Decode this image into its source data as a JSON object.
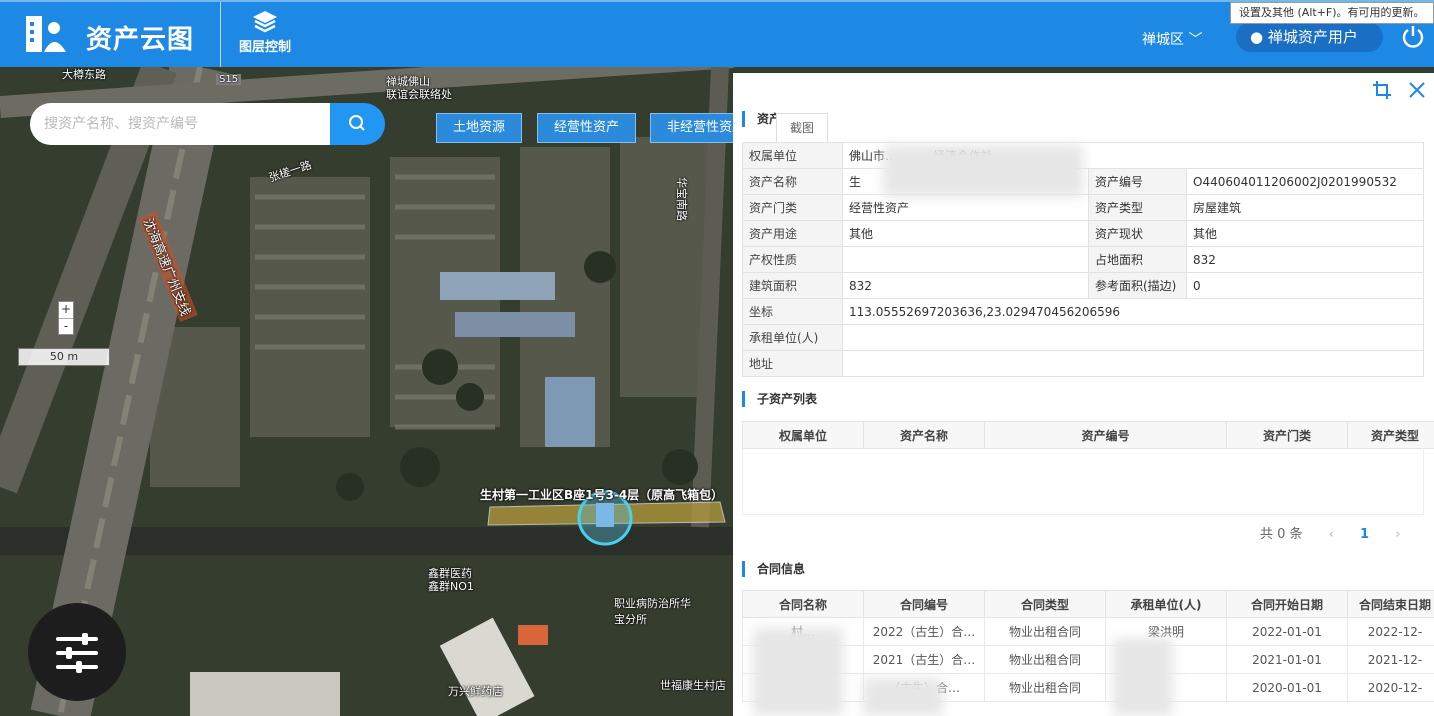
{
  "header": {
    "app_title": "资产云图",
    "layers_label": "图层控制",
    "district": "禅城区 ﹀",
    "user_name": "禅城资产用户",
    "tooltip": "设置及其他 (Alt+F)。有可用的更新。"
  },
  "map": {
    "search_placeholder": "搜资产名称、搜资产编号",
    "filters": [
      "土地资源",
      "经营性资产",
      "非经营性资产"
    ],
    "zoom_in": "+",
    "zoom_out": "-",
    "scale": "50 m",
    "labels": {
      "l1": "大樽东路",
      "l2": "S15",
      "l3": "禅城佛山",
      "l4": "联谊会联络处",
      "l5": "张槎一路",
      "l6": "沈海高速广州支线",
      "l7": "华宝南路",
      "l8": "生村第一工业区B座1号3-4层（原高飞箱包）",
      "l9": "鑫群医药",
      "l10": "鑫群NO1",
      "l11": "职业病防治所华宝分所",
      "l12": "万兴鲜药店",
      "l13": "世福康生村店"
    }
  },
  "panel": {
    "section_asset": "资产",
    "tab_screenshot": "截图",
    "info": {
      "owner_label": "权属单位",
      "owner_value": "佛山市…………经济合作社",
      "name_label": "资产名称",
      "name_value": "生",
      "code_label": "资产编号",
      "code_value": "O440604011206002J0201990532",
      "category_label": "资产门类",
      "category_value": "经营性资产",
      "type_label": "资产类型",
      "type_value": "房屋建筑",
      "use_label": "资产用途",
      "use_value": "其他",
      "status_label": "资产现状",
      "status_value": "其他",
      "right_label": "产权性质",
      "right_value": "",
      "land_area_label": "占地面积",
      "land_area_value": "832",
      "build_area_label": "建筑面积",
      "build_area_value": "832",
      "ref_area_label": "参考面积(描边)",
      "ref_area_value": "0",
      "coord_label": "坐标",
      "coord_value": "113.05552697203636,23.029470456206596",
      "lessee_label": "承租单位(人)",
      "lessee_value": "",
      "address_label": "地址",
      "address_value": ""
    },
    "sub_title": "子资产列表",
    "sub_headers": [
      "权属单位",
      "资产名称",
      "资产编号",
      "资产门类",
      "资产类型"
    ],
    "pager": {
      "total": "共 0 条",
      "prev": "‹",
      "page": "1",
      "next": "›"
    },
    "contract_title": "合同信息",
    "contract_headers": [
      "合同名称",
      "合同编号",
      "合同类型",
      "承租单位(人)",
      "合同开始日期",
      "合同结束日期"
    ],
    "contracts": [
      [
        "村…",
        "2022（古生）合…",
        "物业出租合同",
        "梁洪明",
        "2022-01-01",
        "2022-12-"
      ],
      [
        "…",
        "2021（古生）合…",
        "物业出租合同",
        "",
        "2021-01-01",
        "2021-12-"
      ],
      [
        "生…",
        "（古生）合…",
        "物业出租合同",
        "",
        "2020-01-01",
        "2020-12-"
      ]
    ]
  }
}
